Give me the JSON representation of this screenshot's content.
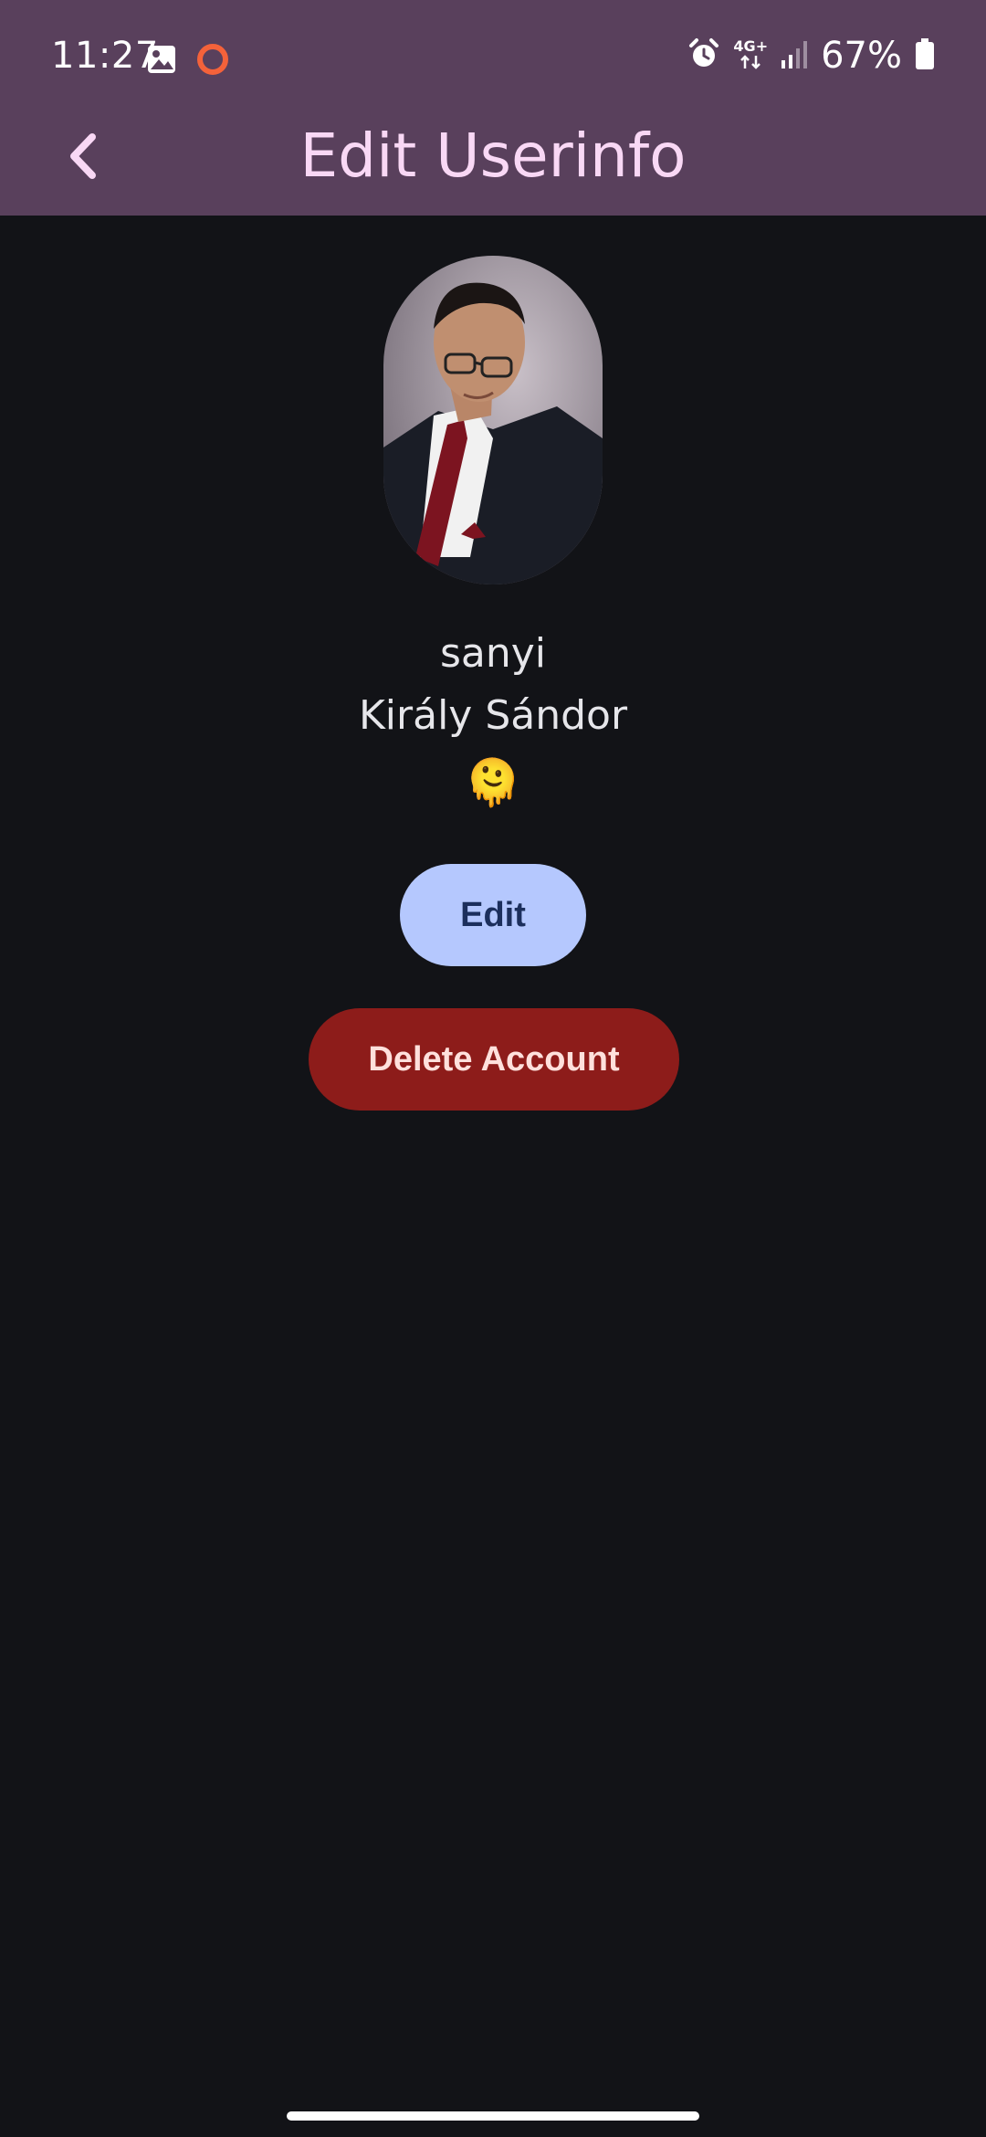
{
  "status_bar": {
    "time": "11:27",
    "network_type": "4G+",
    "battery_percent": "67%",
    "icons": [
      "image-icon",
      "record-ring-icon",
      "alarm-icon",
      "data-arrows-icon",
      "signal-icon",
      "battery-icon"
    ]
  },
  "app_bar": {
    "title": "Edit Userinfo",
    "back_icon": "chevron-left-icon"
  },
  "profile": {
    "username": "sanyi",
    "full_name": "Király Sándor",
    "emoji": "🫠"
  },
  "actions": {
    "edit_label": "Edit",
    "delete_label": "Delete Account"
  },
  "colors": {
    "app_bar_bg": "#59405c",
    "page_bg": "#121317",
    "title": "#f9d8f5",
    "edit_bg": "#b5c8fe",
    "edit_text": "#1c2f5c",
    "delete_bg": "#8d1c1a",
    "delete_text": "#ffe0dc"
  }
}
